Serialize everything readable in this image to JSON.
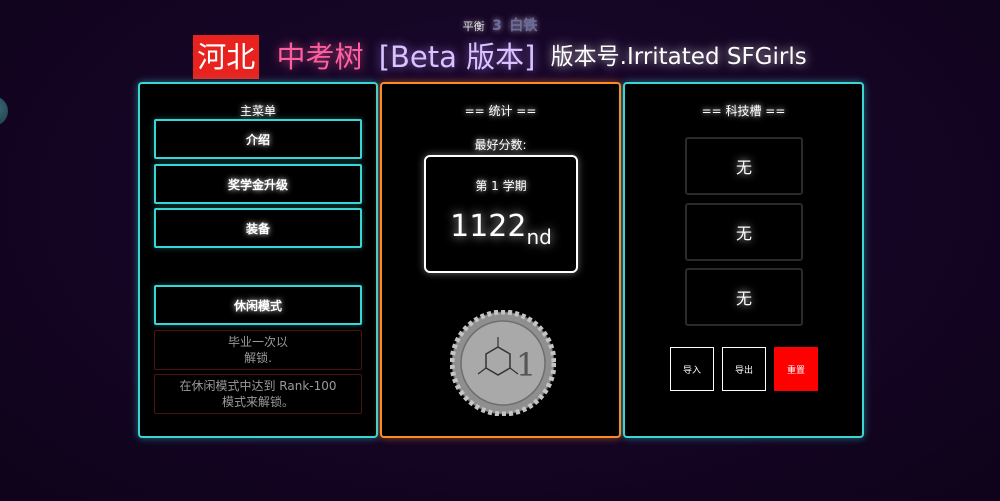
{
  "status": {
    "balance_label": "平衡",
    "balance_value": "3",
    "grade": "白铁"
  },
  "header": {
    "province": "河北",
    "game_name": "中考树",
    "beta_tag": "[Beta 版本]",
    "version": "版本号.Irritated SFGirls"
  },
  "main_menu": {
    "title": "主菜单",
    "intro_label": "介绍",
    "scholarship_label": "奖学金升级",
    "equipment_label": "装备",
    "casual_mode_label": "休闲模式",
    "locked_1_line1": "毕业一次以",
    "locked_1_line2": "解锁.",
    "locked_2_line1": "在休闲模式中达到 Rank-100",
    "locked_2_line2": "模式来解锁。"
  },
  "stats": {
    "title": "== 统计 ==",
    "best_score_label": "最好分数:",
    "semester": "第 1 学期",
    "rank_number": "1122",
    "rank_suffix": "nd",
    "coin_numeral": "1"
  },
  "tech": {
    "title": "== 科技槽 ==",
    "slots": [
      "无",
      "无",
      "无"
    ],
    "import_label": "导入",
    "export_label": "导出",
    "reset_label": "重置"
  },
  "colors": {
    "cyan_border": "#39d6d6",
    "orange_border": "#ff8a1f",
    "province_red": "#e8231f",
    "game_name_pink": "#ff5fa0",
    "reset_red": "#ff0000"
  }
}
